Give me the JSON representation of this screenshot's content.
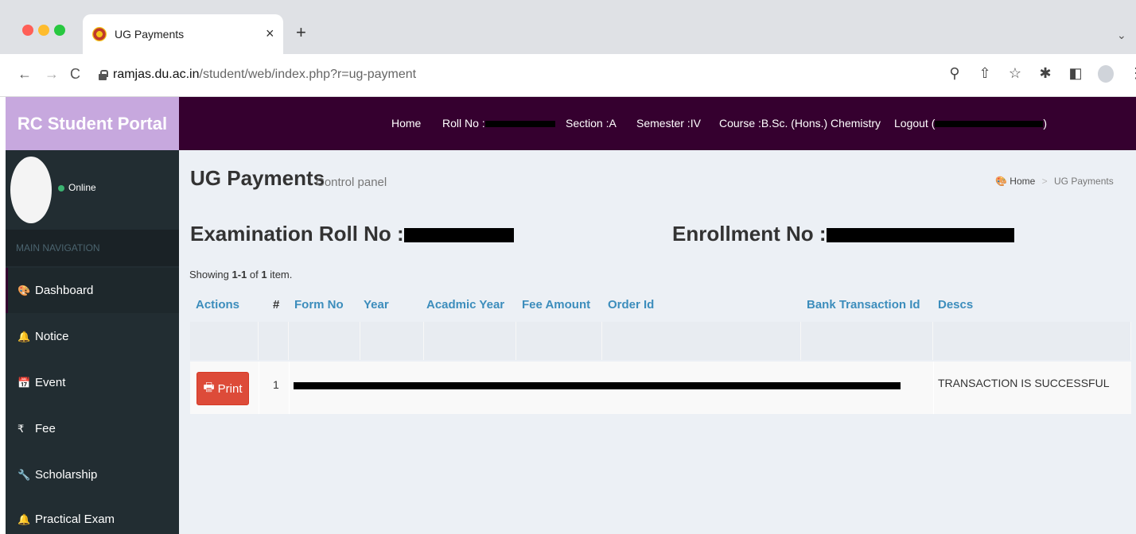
{
  "browser": {
    "tab_title": "UG Payments",
    "tab_close": "×",
    "new_tab": "+",
    "tab_menu": "⌄",
    "url_host": "ramjas.du.ac.in",
    "url_path": "/student/web/index.php?r=ug-payment",
    "icons": {
      "back": "←",
      "forward": "→",
      "reload": "C",
      "zoom": "⚲",
      "share": "⇧",
      "bookmark": "☆",
      "extensions": "✱",
      "sidepanel": "◧",
      "menu": "⋮"
    }
  },
  "header": {
    "brand": "RC Student Portal",
    "nav": {
      "home": "Home",
      "roll_no": "Roll No :",
      "section": "Section :A",
      "semester": "Semester :IV",
      "course": "Course :B.Sc. (Hons.) Chemistry",
      "logout_prefix": "Logout (",
      "logout_suffix": ")"
    }
  },
  "sidebar": {
    "user_status": "Online",
    "nav_header": "MAIN NAVIGATION",
    "items": [
      {
        "label": "Dashboard",
        "icon": "dashboard-icon",
        "glyph": "🎨"
      },
      {
        "label": "Notice",
        "icon": "bell-icon",
        "glyph": "🔔"
      },
      {
        "label": "Event",
        "icon": "calendar-icon",
        "glyph": "📅"
      },
      {
        "label": "Fee",
        "icon": "rupee-icon",
        "glyph": "₹"
      },
      {
        "label": "Scholarship",
        "icon": "wrench-icon",
        "glyph": "🔧"
      },
      {
        "label": "Practical Exam",
        "icon": "bell-icon",
        "glyph": "🔔"
      }
    ]
  },
  "content": {
    "title": "UG Payments",
    "subtitle": "Control panel",
    "breadcrumb": {
      "home": "Home",
      "separator": ">",
      "current": "UG Payments"
    },
    "exam_roll_label": "Examination Roll No :",
    "enrollment_label": "Enrollment No :",
    "summary": {
      "prefix": "Showing ",
      "range": "1-1",
      "mid": " of ",
      "total": "1",
      "suffix": " item."
    },
    "table": {
      "headers": {
        "actions": "Actions",
        "number": "#",
        "form_no": "Form No",
        "year": "Year",
        "academic_year": "Acadmic Year",
        "fee_amount": "Fee Amount",
        "order_id": "Order Id",
        "bank_txn": "Bank Transaction Id",
        "descs": "Descs"
      },
      "rows": [
        {
          "print_label": "Print",
          "number": "1",
          "descs": "TRANSACTION IS SUCCESSFUL"
        }
      ]
    }
  }
}
